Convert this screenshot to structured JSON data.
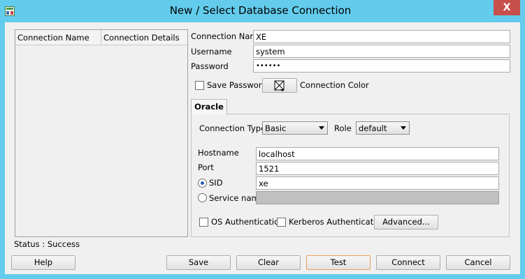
{
  "window": {
    "title": "New / Select Database Connection",
    "close_glyph": "X"
  },
  "list": {
    "col_name": "Connection Name",
    "col_details": "Connection Details"
  },
  "form": {
    "connection_name_label": "Connection Name",
    "connection_name_value": "XE",
    "username_label": "Username",
    "username_value": "system",
    "password_label": "Password",
    "password_value": "••••••",
    "save_password_label": "Save Password",
    "save_password_checked": false,
    "connection_color_label": "Connection Color"
  },
  "tabs": [
    {
      "label": "Oracle",
      "selected": true
    }
  ],
  "oracle": {
    "connection_type_label": "Connection Type",
    "connection_type_value": "Basic",
    "role_label": "Role",
    "role_value": "default",
    "hostname_label": "Hostname",
    "hostname_value": "localhost",
    "port_label": "Port",
    "port_value": "1521",
    "sid_label": "SID",
    "sid_value": "xe",
    "sid_selected": true,
    "service_name_label": "Service name",
    "service_name_value": "",
    "os_auth_label": "OS Authentication",
    "kerberos_label": "Kerberos Authentication",
    "advanced_label": "Advanced..."
  },
  "status": "Status : Success",
  "buttons": {
    "help": "Help",
    "save": "Save",
    "clear": "Clear",
    "test": "Test",
    "connect": "Connect",
    "cancel": "Cancel"
  },
  "colors": {
    "titlebar": "#63ccec",
    "close": "#c7504b",
    "default_button_border": "#e7a35a"
  }
}
